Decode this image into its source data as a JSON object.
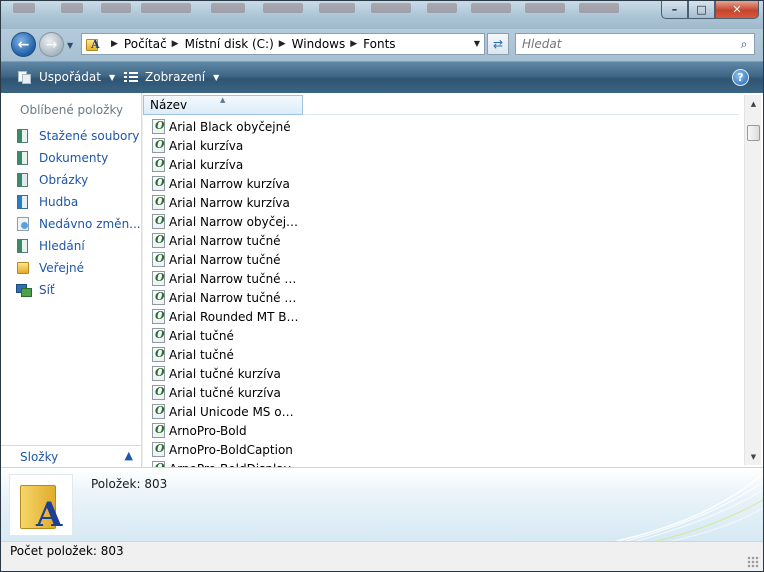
{
  "address": {
    "crumbs": [
      "Počítač",
      "Místní disk (C:)",
      "Windows",
      "Fonts"
    ]
  },
  "search": {
    "placeholder": "Hledat"
  },
  "toolbar": {
    "organize_label": "Uspořádat",
    "views_label": "Zobrazení",
    "help_label": "?"
  },
  "navpane": {
    "favorites_title": "Oblíbené položky",
    "items": [
      {
        "label": "Stažené soubory",
        "icon": "downloads-icon"
      },
      {
        "label": "Dokumenty",
        "icon": "documents-icon"
      },
      {
        "label": "Obrázky",
        "icon": "pictures-icon"
      },
      {
        "label": "Hudba",
        "icon": "music-icon"
      },
      {
        "label": "Nedávno změn...",
        "icon": "recent-icon"
      },
      {
        "label": "Hledání",
        "icon": "searches-icon"
      },
      {
        "label": "Veřejné",
        "icon": "public-folder-icon"
      },
      {
        "label": "Síť",
        "icon": "network-icon"
      }
    ],
    "folders_label": "Složky"
  },
  "filelist": {
    "column_name": "Název",
    "rows": [
      "Arial Black obyčejné",
      "Arial kurzíva",
      "Arial kurzíva",
      "Arial Narrow kurzíva",
      "Arial Narrow kurzíva",
      "Arial Narrow obyčejné",
      "Arial Narrow tučné",
      "Arial Narrow tučné",
      "Arial Narrow tučné kur...",
      "Arial Narrow tučné kur...",
      "Arial Rounded MT Bol...",
      "Arial tučné",
      "Arial tučné",
      "Arial tučné kurzíva",
      "Arial tučné kurzíva",
      "Arial Unicode MS obyč...",
      "ArnoPro-Bold",
      "ArnoPro-BoldCaption",
      "ArnoPro-BoldDisplay"
    ]
  },
  "details": {
    "count_text": "Položek: 803"
  },
  "status": {
    "text": "Počet položek: 803"
  },
  "colors": {
    "link": "#1e56a8",
    "command_bar": "#3f6685",
    "close_button": "#c4452d"
  }
}
